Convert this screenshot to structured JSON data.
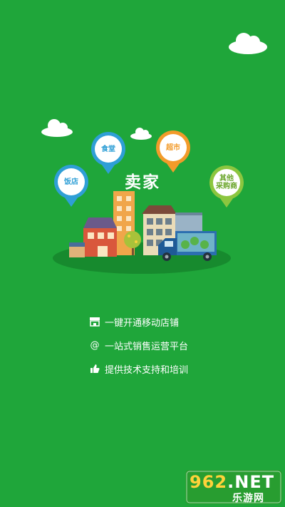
{
  "scene": {
    "title": "卖家",
    "pins": [
      {
        "label": "饭店",
        "color": "#2f9fd6"
      },
      {
        "label": "食堂",
        "color": "#2f9fd6"
      },
      {
        "label": "超市",
        "color": "#f29b2a"
      },
      {
        "label": "其他\n采购商",
        "color": "#8cc63f"
      }
    ]
  },
  "features": [
    {
      "icon": "store-icon",
      "text": "一键开通移动店铺"
    },
    {
      "icon": "at-icon",
      "text": "一站式销售运营平台"
    },
    {
      "icon": "thumbs-up-icon",
      "text": "提供技术支持和培训"
    }
  ],
  "watermark": {
    "number": "962",
    "suffix": ".NET",
    "site": "乐游网"
  },
  "colors": {
    "background": "#1fa63a",
    "blue_pin": "#2f9fd6",
    "orange_pin": "#f29b2a",
    "green_pin": "#8cc63f"
  }
}
